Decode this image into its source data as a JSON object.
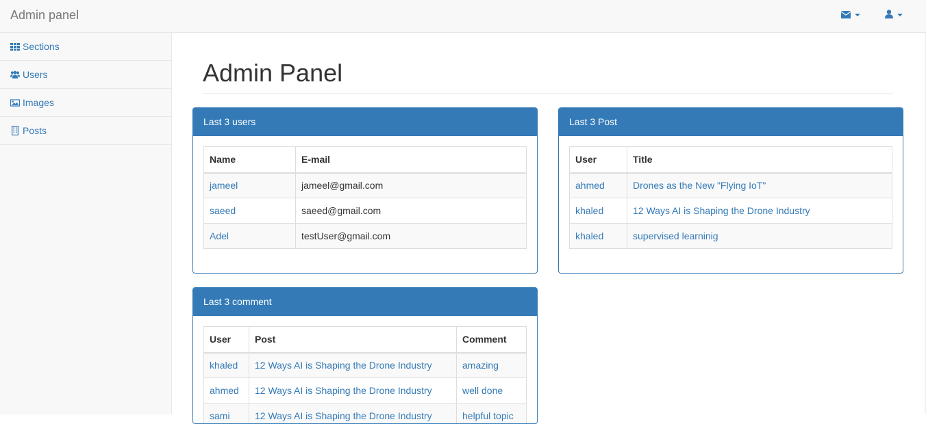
{
  "navbar": {
    "brand": "Admin panel",
    "mail_icon": "envelope-icon",
    "user_icon": "user-icon"
  },
  "sidebar": {
    "items": [
      {
        "label": "Sections",
        "icon": "grid-icon"
      },
      {
        "label": "Users",
        "icon": "users-icon"
      },
      {
        "label": "Images",
        "icon": "picture-icon"
      },
      {
        "label": "Posts",
        "icon": "building-icon"
      }
    ]
  },
  "page": {
    "title": "Admin Panel"
  },
  "users_panel": {
    "heading": "Last 3 users",
    "columns": [
      "Name",
      "E-mail"
    ],
    "rows": [
      {
        "name": "jameel",
        "email": "jameel@gmail.com"
      },
      {
        "name": "saeed",
        "email": "saeed@gmail.com"
      },
      {
        "name": "Adel",
        "email": "testUser@gmail.com"
      }
    ]
  },
  "posts_panel": {
    "heading": "Last 3 Post",
    "columns": [
      "User",
      "Title"
    ],
    "rows": [
      {
        "user": "ahmed",
        "title": "Drones as the New \"Flying IoT\""
      },
      {
        "user": "khaled",
        "title": "12 Ways AI is Shaping the Drone Industry"
      },
      {
        "user": "khaled",
        "title": "supervised learninig"
      }
    ]
  },
  "comments_panel": {
    "heading": "Last 3 comment",
    "columns": [
      "User",
      "Post",
      "Comment"
    ],
    "rows": [
      {
        "user": "khaled",
        "post": "12 Ways AI is Shaping the Drone Industry",
        "comment": "amazing"
      },
      {
        "user": "ahmed",
        "post": "12 Ways AI is Shaping the Drone Industry",
        "comment": "well done"
      },
      {
        "user": "sami",
        "post": "12 Ways AI is Shaping the Drone Industry",
        "comment": "helpful topic"
      }
    ]
  },
  "colors": {
    "primary": "#337ab7",
    "navbar_bg": "#f8f8f8",
    "text": "#333333"
  }
}
